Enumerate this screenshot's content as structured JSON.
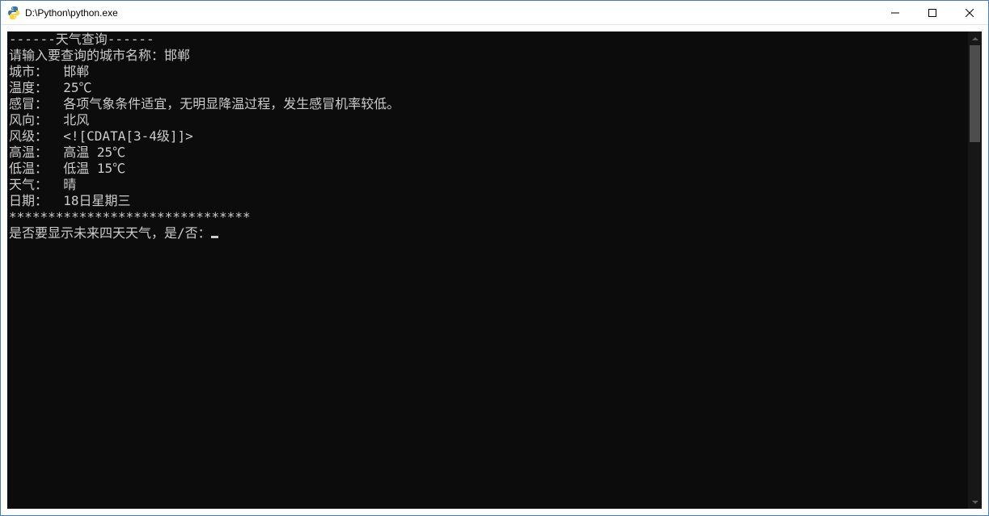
{
  "window": {
    "title": "D:\\Python\\python.exe"
  },
  "console": {
    "lines": [
      "------天气查询------",
      "请输入要查询的城市名称：邯郸",
      "城市：  邯郸",
      "温度：  25℃",
      "感冒：  各项气象条件适宜，无明显降温过程，发生感冒机率较低。",
      "风向：  北风",
      "风级：  <![CDATA[3-4级]]>",
      "高温：  高温 25℃",
      "低温：  低温 15℃",
      "天气：  晴",
      "日期：  18日星期三",
      "*******************************",
      "是否要显示未来四天天气，是/否："
    ]
  }
}
